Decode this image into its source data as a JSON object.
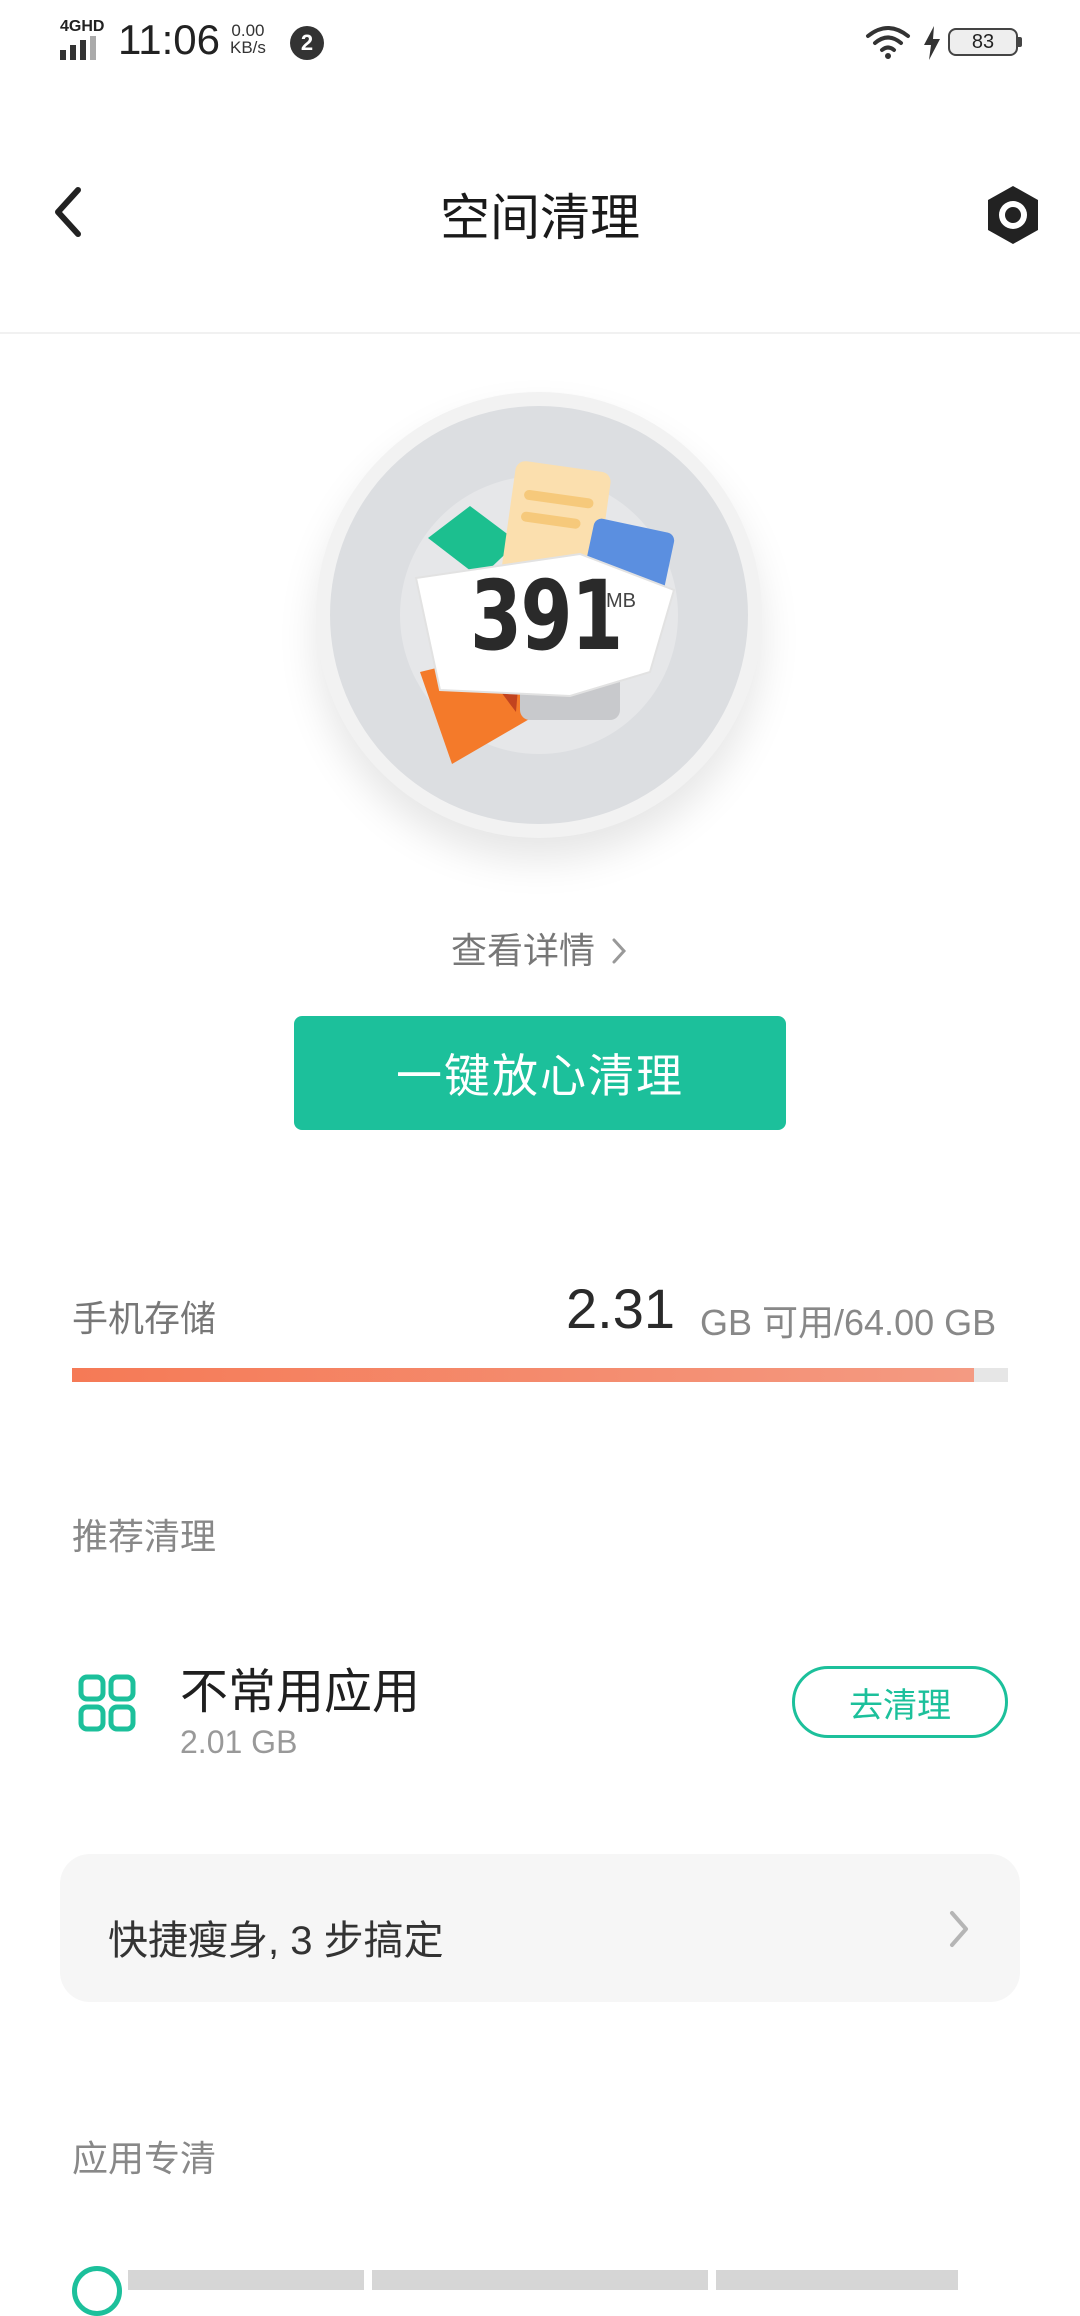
{
  "status_bar": {
    "network_label": "4GHD",
    "time": "11:06",
    "net_rate_value": "0.00",
    "net_rate_unit": "KB/s",
    "notification_count": "2",
    "battery_level": "83"
  },
  "header": {
    "title": "空间清理",
    "back_icon": "chevron-left-icon",
    "settings_icon": "gear-icon"
  },
  "hero": {
    "junk_size_value": "391",
    "junk_size_unit": "MB",
    "details_link": "查看详情"
  },
  "primary_action": {
    "label": "一键放心清理",
    "color": "#1cc09b"
  },
  "storage": {
    "label": "手机存储",
    "available_value": "2.31",
    "available_suffix": "GB 可用/64.00 GB",
    "used_fraction": 0.964,
    "bar_color_start": "#f57a56",
    "bar_color_end": "#f49a82"
  },
  "recommend": {
    "section_title": "推荐清理",
    "item": {
      "icon": "apps-grid-icon",
      "title": "不常用应用",
      "size": "2.01 GB",
      "action_label": "去清理"
    }
  },
  "quick_slim": {
    "label": "快捷瘦身, 3 步搞定",
    "arrow_icon": "chevron-right-icon"
  },
  "app_clean": {
    "section_title": "应用专清"
  }
}
